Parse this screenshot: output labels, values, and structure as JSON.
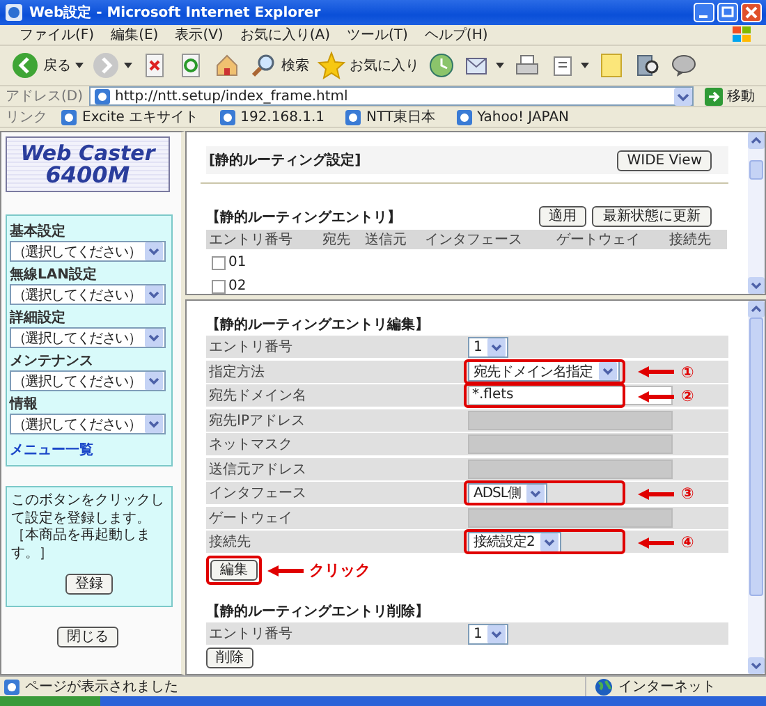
{
  "window": {
    "title": "Web設定 - Microsoft Internet Explorer"
  },
  "menu": [
    "ファイル(F)",
    "編集(E)",
    "表示(V)",
    "お気に入り(A)",
    "ツール(T)",
    "ヘルプ(H)"
  ],
  "toolbar": [
    {
      "kind": "back",
      "label": "戻る"
    },
    {
      "kind": "forward"
    },
    {
      "kind": "stop"
    },
    {
      "kind": "refresh"
    },
    {
      "kind": "home"
    },
    {
      "kind": "search",
      "label": "検索"
    },
    {
      "kind": "favorites",
      "label": "お気に入り"
    },
    {
      "kind": "history"
    },
    {
      "kind": "mail"
    },
    {
      "kind": "print"
    },
    {
      "kind": "edit"
    },
    {
      "kind": "notes"
    },
    {
      "kind": "research"
    },
    {
      "kind": "messenger"
    }
  ],
  "address": {
    "label": "アドレス(D)",
    "url": "http://ntt.setup/index_frame.html",
    "go": "移動"
  },
  "links": {
    "label": "リンク",
    "items": [
      "Excite エキサイト",
      "192.168.1.1",
      "NTT東日本",
      "Yahoo!  JAPAN"
    ]
  },
  "sidebar": {
    "logo": [
      "Web Caster",
      "6400M"
    ],
    "groups": [
      {
        "label": "基本設定",
        "value": "（選択してください）"
      },
      {
        "label": "無線LAN設定",
        "value": "（選択してください）"
      },
      {
        "label": "詳細設定",
        "value": "（選択してください）"
      },
      {
        "label": "メンテナンス",
        "value": "（選択してください）"
      },
      {
        "label": "情報",
        "value": "（選択してください）"
      }
    ],
    "menu_link": "メニュー一覧",
    "note": "このボタンをクリックして設定を登録します。［本商品を再起動します。］",
    "register": "登録",
    "close": "閉じる"
  },
  "settings": {
    "title": "[静的ルーティング設定]",
    "wide_view": "WIDE View",
    "entries": {
      "title": "【静的ルーティングエントリ】",
      "buttons": [
        "適用",
        "最新状態に更新"
      ],
      "columns": [
        "エントリ番号",
        "宛先",
        "送信元",
        "インタフェース",
        "ゲートウェイ",
        "接続先"
      ],
      "rows": [
        {
          "number": "01",
          "checked": false
        },
        {
          "number": "02",
          "checked": false
        }
      ]
    }
  },
  "edit": {
    "title": "【静的ルーティングエントリ編集】",
    "rows": [
      {
        "label": "エントリ番号",
        "kind": "select",
        "value": "1"
      },
      {
        "label": "指定方法",
        "kind": "select",
        "value": "宛先ドメイン名指定",
        "callout": "①"
      },
      {
        "label": "宛先ドメイン名",
        "kind": "text",
        "value": "*.flets",
        "disabled": false,
        "callout": "②"
      },
      {
        "label": "宛先IPアドレス",
        "kind": "text",
        "disabled": true
      },
      {
        "label": "ネットマスク",
        "kind": "text",
        "disabled": true
      },
      {
        "label": "送信元アドレス",
        "kind": "text",
        "disabled": true
      },
      {
        "label": "インタフェース",
        "kind": "select",
        "value": "ADSL側",
        "callout": "③"
      },
      {
        "label": "ゲートウェイ",
        "kind": "text",
        "disabled": true
      },
      {
        "label": "接続先",
        "kind": "select",
        "value": "接続設定2",
        "callout": "④"
      }
    ],
    "button": {
      "label": "編集",
      "callout": "クリック"
    }
  },
  "delete": {
    "title": "【静的ルーティングエントリ削除】",
    "rows": [
      {
        "label": "エントリ番号",
        "kind": "select",
        "value": "1"
      }
    ],
    "button": "削除"
  },
  "status_bar": {
    "text": "ページが表示されました",
    "zone": "インターネット"
  }
}
